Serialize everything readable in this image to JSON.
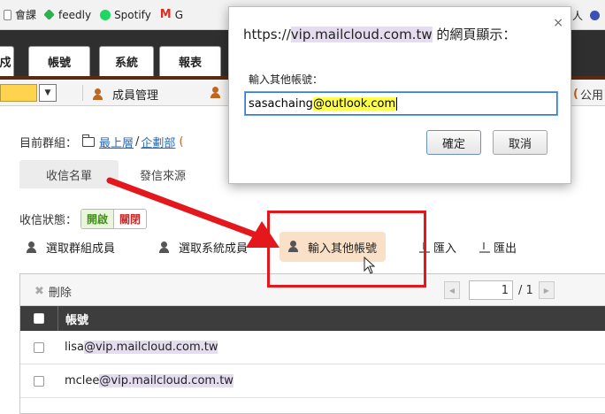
{
  "bookmarks": [
    {
      "label": "會課",
      "icon": "page-icon"
    },
    {
      "label": "feedly",
      "icon": "feedly-icon"
    },
    {
      "label": "Spotify",
      "icon": "spotify-icon"
    },
    {
      "label": "G",
      "icon": "gmail-icon"
    }
  ],
  "bookmarks_right": {
    "label": "人",
    "icon": "extension-icon"
  },
  "app_tabs": [
    {
      "label": "戍"
    },
    {
      "label": "帳號"
    },
    {
      "label": "系統"
    },
    {
      "label": "報表"
    }
  ],
  "subbar": {
    "member_mgmt": "成員管理",
    "public": "公用"
  },
  "content": {
    "breadcrumb_label": "目前群組：",
    "breadcrumb_root": "最上層",
    "breadcrumb_sep": "/",
    "breadcrumb_dept": "企劃部",
    "breadcrumb_tail": "(",
    "tabs": [
      "收信名單",
      "發信來源"
    ],
    "status_label": "收信狀態：",
    "status_on": "開啟",
    "status_off": "關閉",
    "actions": {
      "select_group": "選取群組成員",
      "select_system": "選取系統成員",
      "input_other": "輸入其他帳號",
      "import": "匯入",
      "export": "匯出"
    }
  },
  "grid": {
    "delete_label": "刪除",
    "page_current": "1",
    "page_total": "/ 1",
    "column_account": "帳號",
    "rows": [
      {
        "user": "lisa",
        "domain": "@vip.mailcloud.com.tw"
      },
      {
        "user": "mclee",
        "domain": "@vip.mailcloud.com.tw"
      }
    ]
  },
  "dialog": {
    "title_prefix": "https://",
    "title_host": "vip.mailcloud.com.tw",
    "title_suffix": " 的網頁顯示：",
    "close_glyph": "×",
    "prompt": "輸入其他帳號：",
    "input_user": "sasachaing",
    "input_domain": "@outlook.com",
    "ok_label": "確定",
    "cancel_label": "取消"
  },
  "colors": {
    "tab_bar_bg": "#2f2f2f",
    "highlight_button": "#fbe0c8",
    "annotation_red": "#e3171c",
    "text_highlight_yellow": "#ffff4a",
    "text_highlight_purple": "#e5dcf0",
    "status_on_green": "#3f8f17",
    "status_off_red": "#c62828"
  }
}
